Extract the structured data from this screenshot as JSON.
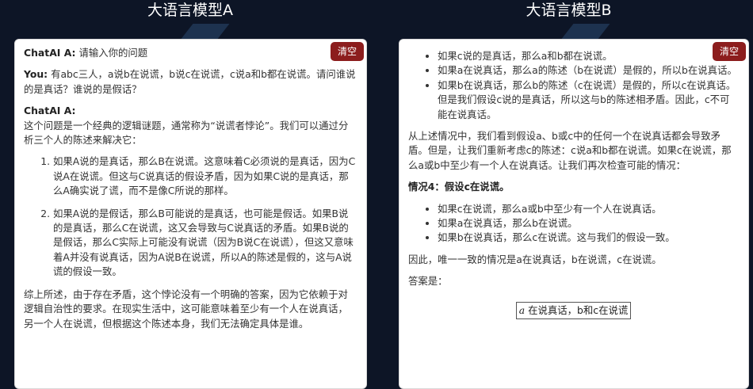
{
  "model_a": {
    "title": "大语言模型A",
    "clear_label": "清空",
    "messages": [
      {
        "speaker": "ChatAI A:",
        "text": " 请输入你的问题"
      },
      {
        "speaker": "You:",
        "text": " 有abc三人，a说b在说谎，b说c在说谎，c说a和b都在说谎。请问谁说的是真话？谁说的是假话？"
      }
    ],
    "reply_speaker": "ChatAI A:",
    "reply_intro": "这个问题是一个经典的逻辑谜题，通常称为“说谎者悖论”。我们可以通过分析三个人的陈述来解决它：",
    "reply_items": [
      "如果A说的是真话，那么B在说谎。这意味着C必须说的是真话，因为C说A在说谎。但这与C说真话的假设矛盾，因为如果C说的是真话，那么A确实说了谎，而不是像C所说的那样。",
      "如果A说的是假话，那么B可能说的是真话，也可能是假话。如果B说的是真话，那么C在说谎，这又会导致与C说真话的矛盾。如果B说的是假话，那么C实际上可能没有说谎（因为B说C在说谎），但这又意味着A并没有说真话，因为A说B在说谎，所以A的陈述是假的，这与A说谎的假设一致。"
    ],
    "reply_conclusion": "综上所述，由于存在矛盾，这个悖论没有一个明确的答案，因为它依赖于对逻辑自治性的要求。在现实生活中，这可能意味着至少有一个人在说真话，另一个人在说谎，但根据这个陈述本身，我们无法确定具体是谁。"
  },
  "model_b": {
    "title": "大语言模型B",
    "clear_label": "清空",
    "top_items": [
      "如果c说的是真话，那么a和b都在说谎。",
      "如果a在说真话，那么a的陈述（b在说谎）是假的，所以b在说真话。",
      "如果b在说真话，那么b的陈述（c在说谎）是假的，所以c在说真话。但是我们假设c说的是真话，所以这与b的陈述相矛盾。因此，c不可能在说真话。"
    ],
    "para1": "从上述情况中，我们看到假设a、b或c中的任何一个在说真话都会导致矛盾。但是，让我们重新考虑c的陈述：c说a和b都在说谎。如果c在说谎，那么a或b中至少有一个人在说真话。让我们再次检查可能的情况：",
    "case4_heading": "情况4：假设c在说谎。",
    "case4_items": [
      "如果c在说谎，那么a或b中至少有一个人在说真话。",
      "如果a在说真话，那么b在说谎。",
      "如果b在说真话，那么c在说谎。这与我们的假设一致。"
    ],
    "para2": "因此，唯一一致的情况是a在说真话，b在说谎，c在说谎。",
    "answer_label": "答案是：",
    "answer_var": "a",
    "answer_text": " 在说真话，b和c在说谎"
  },
  "colors": {
    "background": "#0d1526",
    "panel": "#ffffff",
    "clear_button": "#8c1d1d",
    "text": "#333333"
  }
}
